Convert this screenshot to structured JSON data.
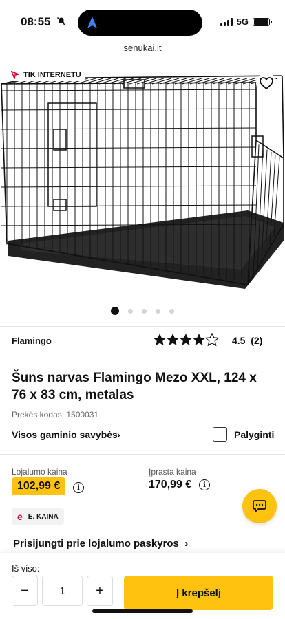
{
  "status": {
    "time": "08:55",
    "network": "5G"
  },
  "browser": {
    "url": "senukai.lt"
  },
  "product": {
    "badge": "TIK INTERNETU",
    "brand": "Flamingo",
    "rating": 4.5,
    "rating_text": "4.5",
    "review_count": "(2)",
    "title": "Šuns narvas Flamingo Mezo XXL, 124 x 76 x 83 cm, metalas",
    "code": "Prekės kodas: 1500031",
    "properties_link": "Visos gaminio savybės",
    "compare_label": "Palyginti",
    "images_total": 5,
    "image_active": 1
  },
  "pricing": {
    "loyal_label": "Lojalumo kaina",
    "loyal_price": "102,99 €",
    "regular_label": "Įprasta kaina",
    "regular_price": "170,99 €",
    "e_price_label": "E. KAINA",
    "e_letter": "e"
  },
  "login_link": "Prisijungti prie lojalumo paskyros",
  "bottom": {
    "total_label": "Iš viso:",
    "minus": "−",
    "quantity": "1",
    "plus": "+",
    "cart_button": "Į krepšelį"
  },
  "colors": {
    "accent": "#ffc20e",
    "eprice": "#d6002a"
  }
}
